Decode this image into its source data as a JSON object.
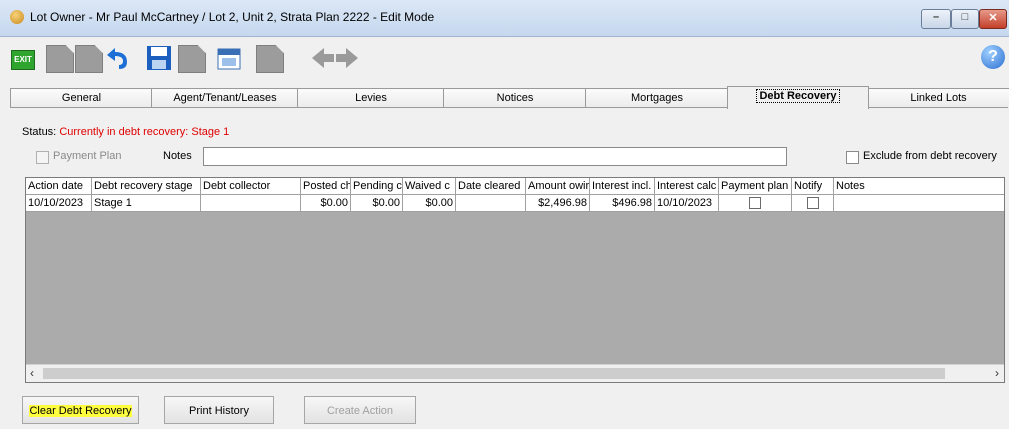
{
  "window": {
    "title": "Lot Owner - Mr Paul McCartney / Lot 2, Unit 2, Strata Plan 2222 - Edit Mode",
    "controls": [
      "minimize",
      "maximize",
      "close"
    ]
  },
  "toolbar": {
    "exit_label": "EXIT",
    "help_label": "?",
    "icons": [
      "exit-icon",
      "new-icon",
      "copy-icon",
      "undo-icon",
      "save-icon",
      "delete-icon",
      "calendar-icon",
      "report-icon",
      "back-arrow-icon",
      "forward-arrow-icon",
      "help-icon"
    ]
  },
  "tabs": [
    "General",
    "Agent/Tenant/Leases",
    "Levies",
    "Notices",
    "Mortgages",
    "Debt Recovery",
    "Linked Lots"
  ],
  "active_tab": "Debt Recovery",
  "status": {
    "label": "Status:",
    "value": "Currently in debt recovery: Stage 1"
  },
  "payment_plan_label": "Payment Plan",
  "notes_label": "Notes",
  "notes_value": "",
  "exclude_label": "Exclude from debt recovery",
  "grid": {
    "columns": [
      "Action date",
      "Debt recovery stage",
      "Debt collector",
      "Posted ch",
      "Pending c",
      "Waived c",
      "Date cleared",
      "Amount owir",
      "Interest incl.",
      "Interest calc",
      "Payment plan",
      "Notify",
      "Notes"
    ],
    "rows": [
      [
        "10/10/2023",
        "Stage 1",
        "",
        "$0.00",
        "$0.00",
        "$0.00",
        "",
        "$2,496.98",
        "$496.98",
        "10/10/2023",
        "",
        "",
        ""
      ]
    ]
  },
  "buttons": {
    "clear": "Clear Debt Recovery",
    "print": "Print History",
    "create": "Create Action"
  },
  "colors": {
    "status_red": "#e00000",
    "highlight": "#ffff40",
    "grid_bg": "#ababab"
  }
}
